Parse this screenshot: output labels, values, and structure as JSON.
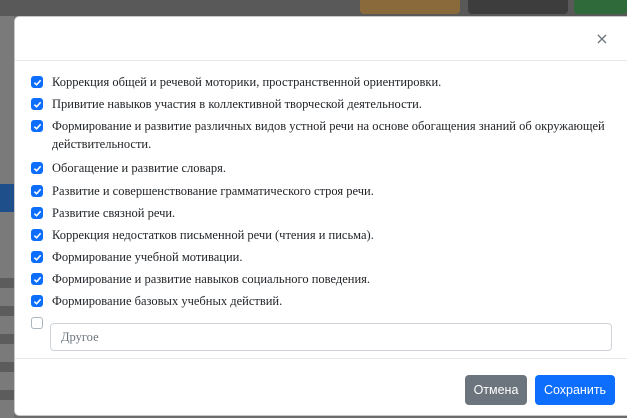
{
  "modal": {
    "close_label": "×",
    "items": [
      {
        "label": "Коррекция общей и речевой моторики, пространственной ориентировки.",
        "checked": true
      },
      {
        "label": "Привитие навыков участия в коллективной творческой деятельности.",
        "checked": true
      },
      {
        "label": "Формирование и развитие различных видов устной речи на основе обогащения знаний об окружающей действительности.",
        "checked": true
      },
      {
        "label": "Обогащение и развитие словаря.",
        "checked": true
      },
      {
        "label": "Развитие и совершенствование грамматического строя речи.",
        "checked": true
      },
      {
        "label": "Развитие связной речи.",
        "checked": true
      },
      {
        "label": "Коррекция недостатков письменной речи (чтения и письма).",
        "checked": true
      },
      {
        "label": "Формирование учебной мотивации.",
        "checked": true
      },
      {
        "label": "Формирование и развитие навыков социального поведения.",
        "checked": true
      },
      {
        "label": "Формирование базовых учебных действий.",
        "checked": true
      }
    ],
    "other": {
      "checked": false,
      "placeholder": "Другое",
      "value": ""
    },
    "buttons": {
      "cancel": "Отмена",
      "save": "Сохранить"
    }
  },
  "colors": {
    "primary": "#0d6efd",
    "secondary": "#6c757d"
  }
}
